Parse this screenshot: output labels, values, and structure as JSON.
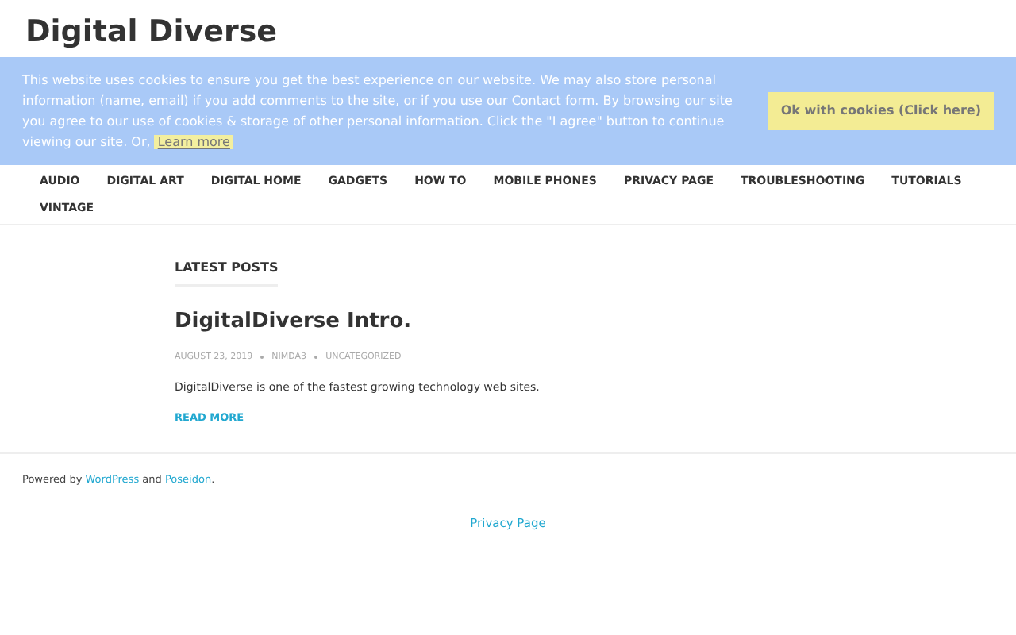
{
  "site_title": "Digital Diverse",
  "cookie_banner": {
    "text": "This website uses cookies to ensure you get the best experience on our website. We may also store personal information (name, email) if you add comments to the site, or if you use our Contact form. By browsing our site you agree to our use of cookies & storage of other personal information. Click the \"I agree\" button to continue viewing our site. Or,",
    "link": "Learn more",
    "button": "Ok with cookies (Click here)"
  },
  "nav": [
    "AUDIO",
    "DIGITAL ART",
    "DIGITAL HOME",
    "GADGETS",
    "HOW TO",
    "MOBILE PHONES",
    "PRIVACY PAGE",
    "TROUBLESHOOTING",
    "TUTORIALS",
    "VINTAGE"
  ],
  "section_title": "LATEST POSTS",
  "post": {
    "title": "DigitalDiverse Intro.",
    "date": "AUGUST 23, 2019",
    "author": "NIMDA3",
    "category": "UNCATEGORIZED",
    "excerpt": "DigitalDiverse is one of the fastest growing technology web sites.",
    "read_more": "READ MORE"
  },
  "footer": {
    "prefix": "Powered by",
    "link1": "WordPress",
    "middle": "and",
    "link2": "Poseidon",
    "suffix": ".",
    "footer_link": "Privacy Page"
  }
}
